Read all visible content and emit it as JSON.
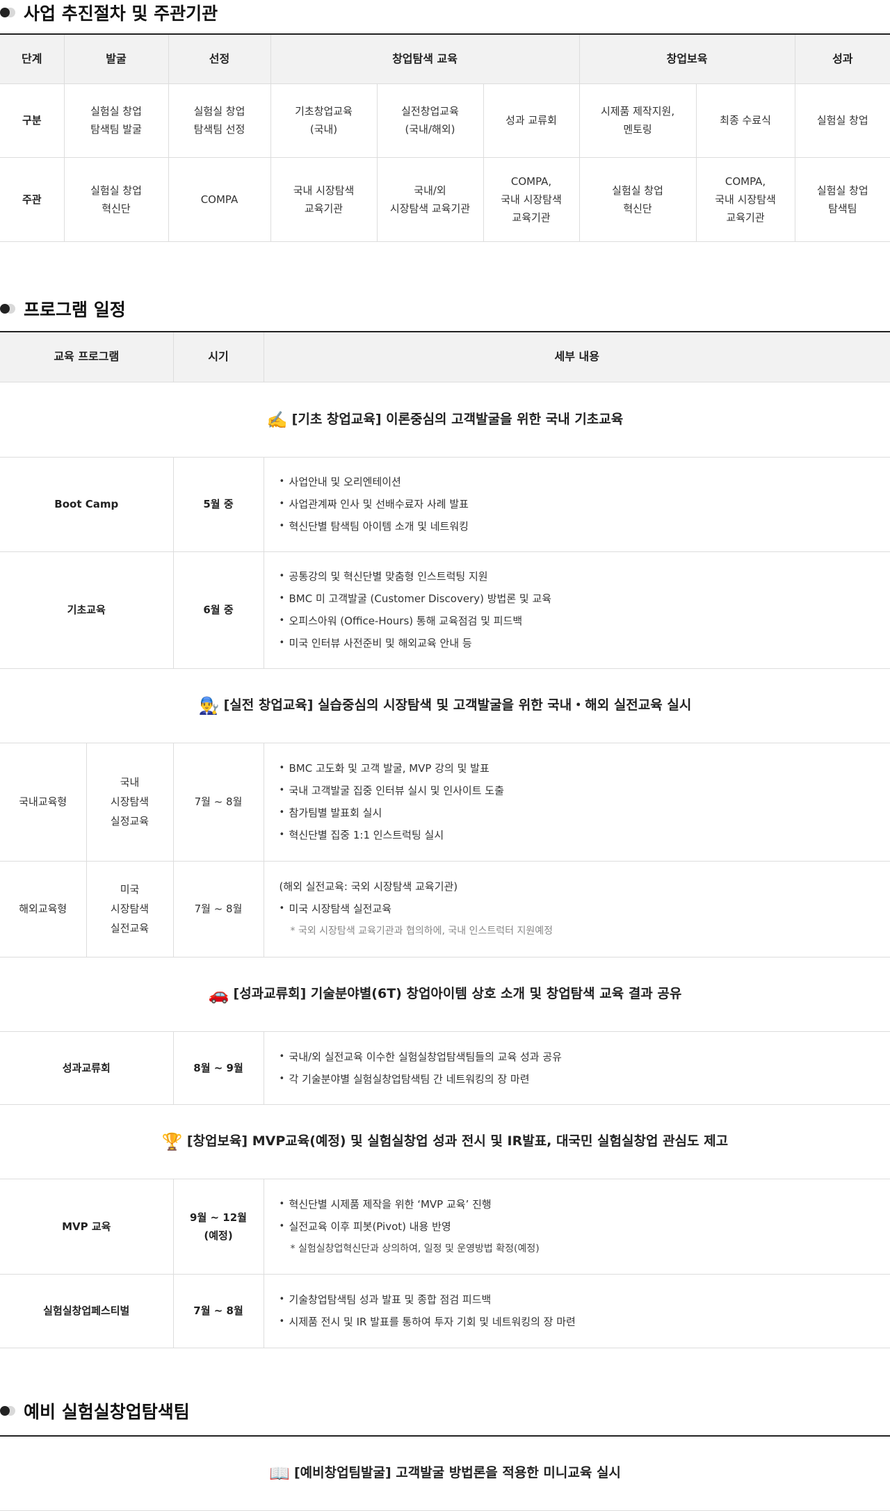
{
  "sections": {
    "procedure": "사업 추진절차 및 주관기관",
    "schedule": "프로그램 일정",
    "preliminary": "예비 실험실창업탐색팀"
  },
  "procedure_table": {
    "header": [
      "단계",
      "발굴",
      "선정",
      "창업탐색 교육",
      "창업보육",
      "성과"
    ],
    "row_category": {
      "label": "구분",
      "cells": [
        "실험실 창업\n탐색팀 발굴",
        "실험실 창업\n탐색팀 선정",
        "기초창업교육\n(국내)",
        "실전창업교육\n(국내/해외)",
        "성과 교류회",
        "시제품 제작지원,\n멘토링",
        "최종 수료식",
        "실험실 창업"
      ]
    },
    "row_host": {
      "label": "주관",
      "cells": [
        "실험실 창업\n혁신단",
        "COMPA",
        "국내 시장탐색\n교육기관",
        "국내/외\n시장탐색 교육기관",
        "COMPA,\n국내 시장탐색\n교육기관",
        "실험실 창업\n혁신단",
        "COMPA,\n국내 시장탐색\n교육기관",
        "실험실 창업\n탐색팀"
      ]
    }
  },
  "schedule_table": {
    "header": [
      "교육 프로그램",
      "시기",
      "세부 내용"
    ],
    "banner1": {
      "emoji": "✍️",
      "text": "[기초 창업교육] 이론중심의 고객발굴을 위한 국내 기초교육"
    },
    "bootcamp": {
      "name": "Boot Camp",
      "period": "5월 중",
      "items": [
        "사업안내 및 오리엔테이션",
        "사업관계짜 인사 및 선배수료자 사례 발표",
        "혁신단별 탐색팀 아이템 소개 및 네트워킹"
      ]
    },
    "basic": {
      "name": "기초교육",
      "period": "6월 중",
      "items": [
        "공통강의 및 혁신단별 맞춤형 인스트럭팅 지원",
        "BMC 미 고객발굴 (Customer Discovery) 방법론 및 교육",
        "오피스아워 (Office-Hours) 통해 교육점검 및 피드백",
        "미국 인터뷰 사전준비 및 해외교육 안내 등"
      ]
    },
    "banner2": {
      "emoji": "👨‍🔧",
      "text": "[실전 창업교육] 실습중심의 시장탐색 및 고객발굴을 위한 국내・해외 실전교육 실시"
    },
    "domestic": {
      "type": "국내교육형",
      "name": "국내\n시장탐색\n실정교육",
      "period": "7월 ~ 8월",
      "items": [
        "BMC 고도화 및 고객 발굴, MVP 강의 및 발표",
        "국내 고객발굴 집중 인터뷰 실시 및 인사이트 도출",
        "참가팀별 발표회 실시",
        "혁신단별 집중 1:1 인스트럭팅 실시"
      ]
    },
    "overseas": {
      "type": "해외교육형",
      "name": "미국\n시장탐색\n실전교육",
      "period": "7월 ~ 8월",
      "pre": "(해외 실전교육: 국외 시장탐색 교육기관)",
      "items": [
        "미국 시장탐색 실전교육"
      ],
      "note": "* 국외 시장탐색 교육기관과 협의하에, 국내 인스트럭터 지원예정"
    },
    "banner3": {
      "emoji": "🚗",
      "text": "[성과교류회] 기술분야별(6T) 창업아이템 상호 소개 및 창업탐색 교육 결과 공유"
    },
    "exchange": {
      "name": "성과교류회",
      "period": "8월 ~ 9월",
      "items": [
        "국내/외 실전교육 이수한 실험실창업탐색팀들의 교육 성과 공유",
        "각 기술분야별 실험실창업탐색팀 간 네트워킹의 장 마련"
      ]
    },
    "banner4": {
      "emoji": "🏆",
      "text": "[창업보육] MVP교육(예정) 및 실험실창업 성과 전시 및 IR발표, 대국민 실험실창업 관심도 제고"
    },
    "mvp": {
      "name": "MVP 교육",
      "period": "9월 ~ 12월\n(예정)",
      "items": [
        "혁신단별 시제품 제작을 위한 ‘MVP 교육’ 진행",
        "실전교육 이후 피봇(Pivot) 내용 반영"
      ],
      "note": "* 실험실창업혁신단과 상의하여, 일정 및 운영방법 확정(예정)"
    },
    "festival": {
      "name": "실험실창업페스티벌",
      "period": "7월 ~ 8월",
      "items": [
        "기술창업탐색팀 성과 발표 및 종합 점검 피드백",
        "시제품 전시 및 IR 발표를 통하여 투자 기회 및 네트워킹의 장 마련"
      ]
    }
  },
  "preliminary_table": {
    "banner": {
      "emoji": "📖",
      "text": "[예비창업팀발굴] 고객발굴 방법론을 적용한 미니교육 실시"
    }
  }
}
